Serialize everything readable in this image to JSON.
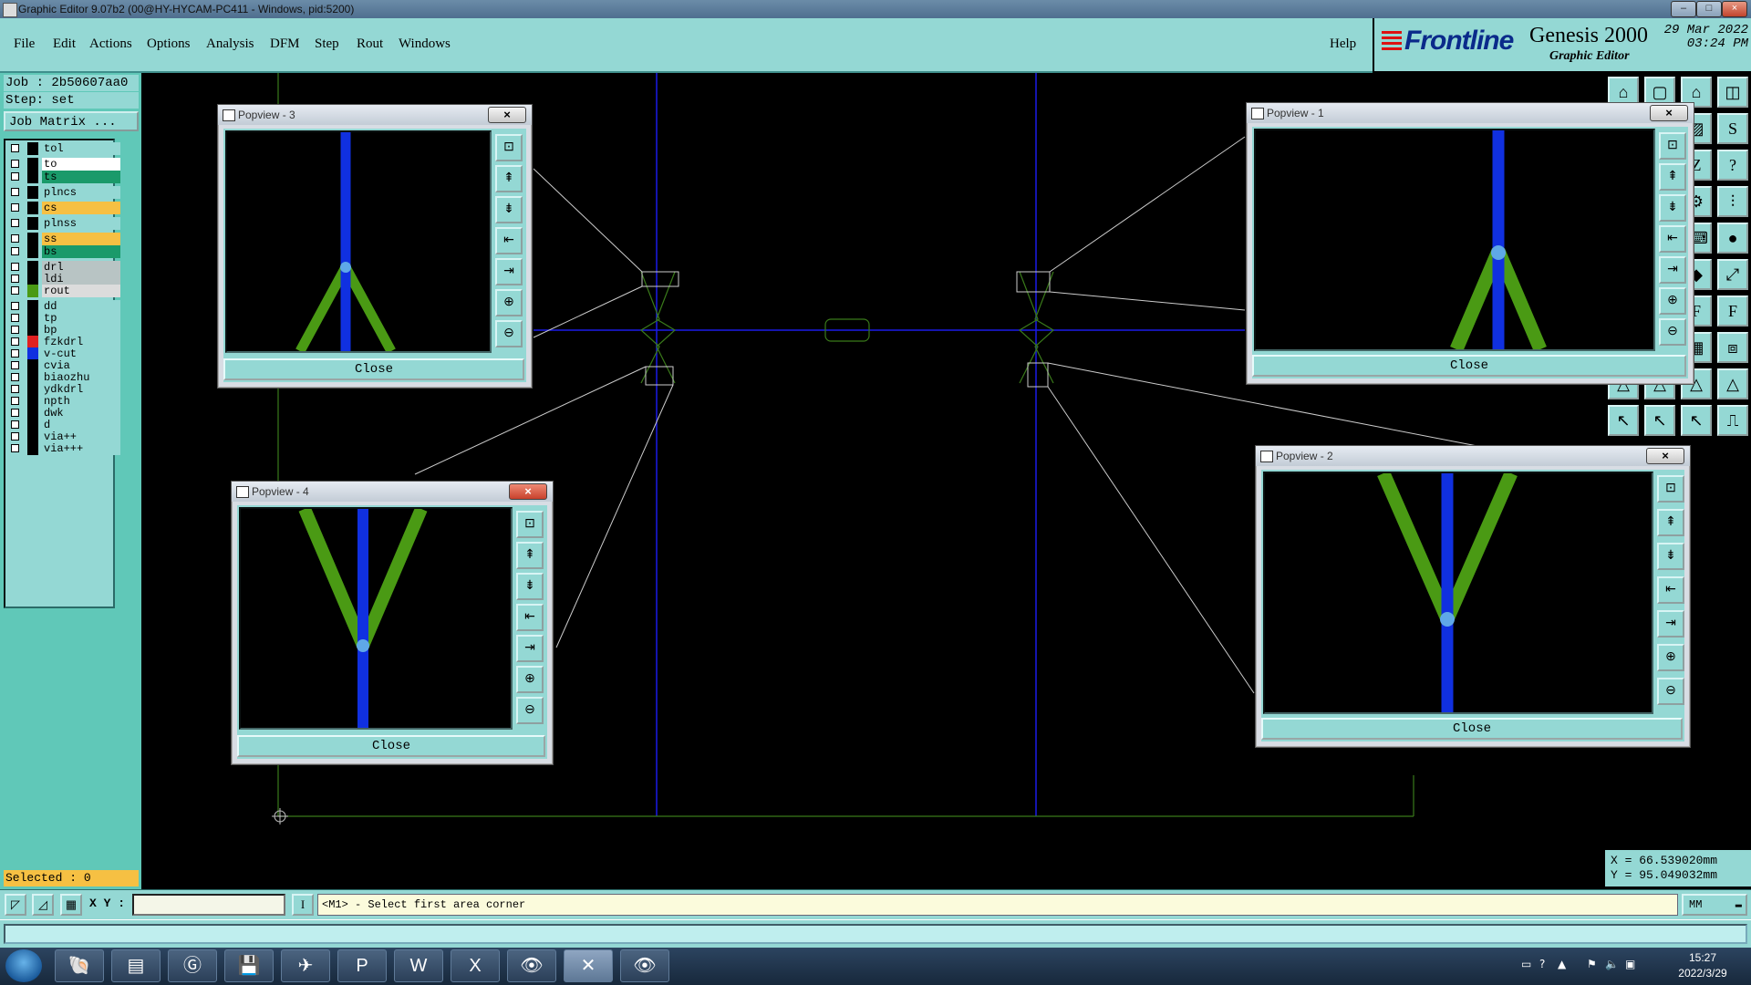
{
  "window": {
    "title": "Graphic Editor 9.07b2 (00@HY-HYCAM-PC411 - Windows, pid:5200)"
  },
  "menu": {
    "items": [
      "File",
      "Edit",
      "Actions",
      "Options",
      "Analysis",
      "DFM",
      "Step",
      "Rout",
      "Windows"
    ],
    "help": "Help"
  },
  "brand": {
    "logo": "Frontline",
    "product": "Genesis 2000",
    "subtitle": "Graphic Editor",
    "date": "29 Mar 2022",
    "time": "03:24 PM"
  },
  "job": {
    "label": "Job : 2b50607aa0",
    "step": "Step: set",
    "matrix_button": "Job Matrix ..."
  },
  "layers": [
    {
      "name": "tol",
      "color": "#94d8d4",
      "swatch": "#000000"
    },
    {
      "name": "to",
      "color": "#ffffff",
      "swatch": "#000000"
    },
    {
      "name": "ts",
      "color": "#1a9a6a",
      "swatch": "#000000"
    },
    {
      "name": "plncs",
      "color": "#94d8d4",
      "swatch": "#000000"
    },
    {
      "name": "cs",
      "color": "#f6c043",
      "swatch": "#000000"
    },
    {
      "name": "plnss",
      "color": "#94d8d4",
      "swatch": "#000000"
    },
    {
      "name": "ss",
      "color": "#f6c043",
      "swatch": "#000000"
    },
    {
      "name": "bs",
      "color": "#1a9a6a",
      "swatch": "#000000"
    },
    {
      "name": "drl",
      "color": "#b8c4c4",
      "swatch": "#000000"
    },
    {
      "name": "ldi",
      "color": "#b8c4c4",
      "swatch": "#000000"
    },
    {
      "name": "rout",
      "color": "#dcdcdc",
      "swatch": "#4a9a14"
    },
    {
      "name": "dd",
      "color": "#94d8d4",
      "swatch": "#000000"
    },
    {
      "name": "tp",
      "color": "#94d8d4",
      "swatch": "#000000"
    },
    {
      "name": "bp",
      "color": "#94d8d4",
      "swatch": "#000000"
    },
    {
      "name": "fzkdrl",
      "color": "#94d8d4",
      "swatch": "#e02020"
    },
    {
      "name": "v-cut",
      "color": "#94d8d4",
      "swatch": "#1030e0"
    },
    {
      "name": "cvia",
      "color": "#94d8d4",
      "swatch": "#000000"
    },
    {
      "name": "biaozhu",
      "color": "#94d8d4",
      "swatch": "#000000"
    },
    {
      "name": "ydkdrl",
      "color": "#94d8d4",
      "swatch": "#000000"
    },
    {
      "name": "npth",
      "color": "#94d8d4",
      "swatch": "#000000"
    },
    {
      "name": "dwk",
      "color": "#94d8d4",
      "swatch": "#000000"
    },
    {
      "name": "d",
      "color": "#94d8d4",
      "swatch": "#000000"
    },
    {
      "name": "via++",
      "color": "#94d8d4",
      "swatch": "#000000"
    },
    {
      "name": "via+++",
      "color": "#94d8d4",
      "swatch": "#000000"
    }
  ],
  "selected": "Selected : 0",
  "popviews": {
    "p1": {
      "title": "Popview - 1",
      "close": "Close"
    },
    "p2": {
      "title": "Popview - 2",
      "close": "Close"
    },
    "p3": {
      "title": "Popview - 3",
      "close": "Close"
    },
    "p4": {
      "title": "Popview - 4",
      "close": "Close"
    }
  },
  "coords": {
    "x": "X = 66.539020mm",
    "y": "Y = 95.049032mm"
  },
  "command": {
    "xy_label": "X Y :",
    "prompt": "<M1> - Select first area corner",
    "units": "MM"
  },
  "taskbar": {
    "time": "15:27",
    "date": "2022/3/29"
  },
  "colors": {
    "vcut": "#1030e0",
    "rout": "#4a9a14",
    "panel": "#94d8d4"
  }
}
